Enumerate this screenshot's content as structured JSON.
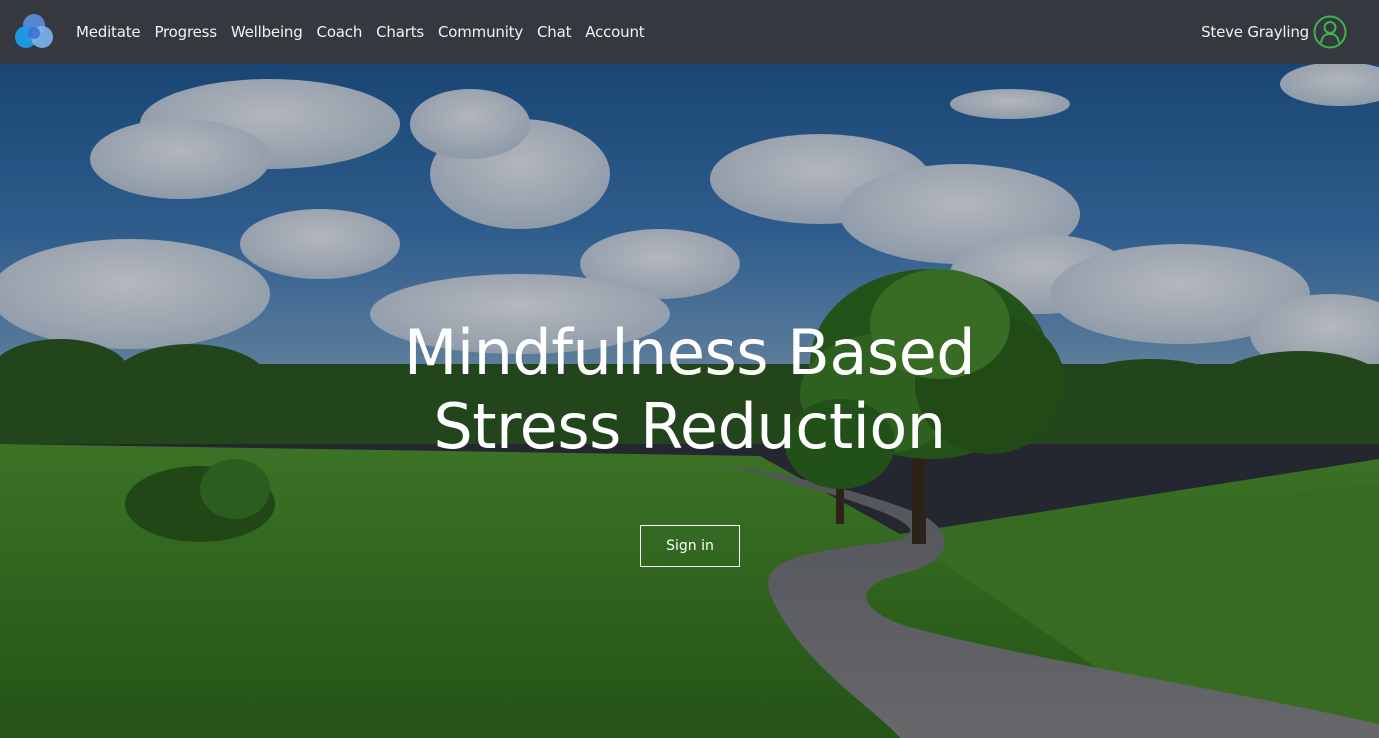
{
  "app": {
    "logo_icon": "overlapping-circles-logo",
    "brand_colors": [
      "#1e90e8",
      "#5aa5ef",
      "#3d6fd6"
    ]
  },
  "nav": {
    "items": [
      {
        "label": "Meditate"
      },
      {
        "label": "Progress"
      },
      {
        "label": "Wellbeing"
      },
      {
        "label": "Coach"
      },
      {
        "label": "Charts"
      },
      {
        "label": "Community"
      },
      {
        "label": "Chat"
      },
      {
        "label": "Account"
      }
    ]
  },
  "user": {
    "name": "Steve Grayling",
    "avatar_icon": "user-outline-icon",
    "avatar_color": "#3cb54a"
  },
  "hero": {
    "title_line1": "Mindfulness Based",
    "title_line2": "Stress Reduction",
    "signin_label": "Sign in",
    "background": "countryside-road-with-trees-and-clouds"
  }
}
